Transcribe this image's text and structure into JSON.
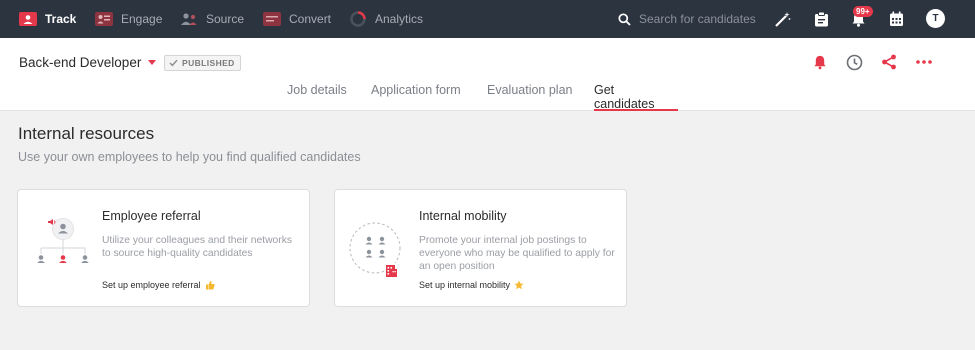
{
  "nav": {
    "items": [
      {
        "label": "Track",
        "icon": "track-icon",
        "active": true
      },
      {
        "label": "Engage",
        "icon": "engage-icon",
        "active": false
      },
      {
        "label": "Source",
        "icon": "source-icon",
        "active": false
      },
      {
        "label": "Convert",
        "icon": "convert-icon",
        "active": false
      },
      {
        "label": "Analytics",
        "icon": "analytics-icon",
        "active": false
      }
    ],
    "search_placeholder": "Search for candidates",
    "notifications_badge": "99+",
    "avatar_initial": "T"
  },
  "header": {
    "job_title": "Back-end Developer",
    "status": "PUBLISHED",
    "tabs": [
      {
        "label": "Job details"
      },
      {
        "label": "Application form"
      },
      {
        "label": "Evaluation plan"
      },
      {
        "label": "Get candidates",
        "active": true
      }
    ]
  },
  "main": {
    "title": "Internal resources",
    "subtitle": "Use your own employees to help you find qualified candidates",
    "cards": [
      {
        "title": "Employee referral",
        "description": "Utilize your colleagues and their networks to source high-quality candidates",
        "link": "Set up employee referral"
      },
      {
        "title": "Internal mobility",
        "description": "Promote your internal job postings to everyone who may be qualified to apply for an open position",
        "link": "Set up internal mobility"
      }
    ]
  },
  "colors": {
    "accent": "#e5394b",
    "nav_bg": "#2c3440",
    "page_bg": "#f1f1f2"
  }
}
